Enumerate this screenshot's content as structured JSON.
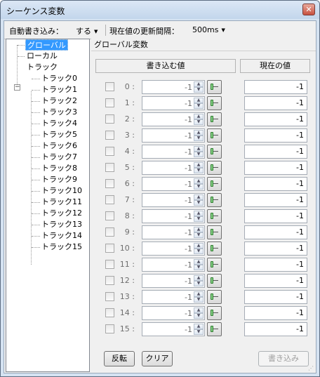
{
  "window": {
    "title": "シーケンス変数",
    "close_icon": "close-icon"
  },
  "toolbar": {
    "auto_write_label": "自動書き込み：",
    "auto_write_value": "する",
    "interval_label": "現在値の更新間隔：",
    "interval_value": "500ms"
  },
  "tree": {
    "global": "グローバル",
    "local": "ローカル",
    "track": "トラック",
    "tracks": [
      "トラック0",
      "トラック1",
      "トラック2",
      "トラック3",
      "トラック4",
      "トラック5",
      "トラック6",
      "トラック7",
      "トラック8",
      "トラック9",
      "トラック10",
      "トラック11",
      "トラック12",
      "トラック13",
      "トラック14",
      "トラック15"
    ]
  },
  "panel": {
    "title": "グローバル変数",
    "write_header": "書き込む値",
    "current_header": "現在の値"
  },
  "rows": [
    {
      "label": "0 :",
      "value": "-1",
      "current": "-1"
    },
    {
      "label": "1 :",
      "value": "-1",
      "current": "-1"
    },
    {
      "label": "2 :",
      "value": "-1",
      "current": "-1"
    },
    {
      "label": "3 :",
      "value": "-1",
      "current": "-1"
    },
    {
      "label": "4 :",
      "value": "-1",
      "current": "-1"
    },
    {
      "label": "5 :",
      "value": "-1",
      "current": "-1"
    },
    {
      "label": "6 :",
      "value": "-1",
      "current": "-1"
    },
    {
      "label": "7 :",
      "value": "-1",
      "current": "-1"
    },
    {
      "label": "8 :",
      "value": "-1",
      "current": "-1"
    },
    {
      "label": "9 :",
      "value": "-1",
      "current": "-1"
    },
    {
      "label": "10 :",
      "value": "-1",
      "current": "-1"
    },
    {
      "label": "11 :",
      "value": "-1",
      "current": "-1"
    },
    {
      "label": "12 :",
      "value": "-1",
      "current": "-1"
    },
    {
      "label": "13 :",
      "value": "-1",
      "current": "-1"
    },
    {
      "label": "14 :",
      "value": "-1",
      "current": "-1"
    },
    {
      "label": "15 :",
      "value": "-1",
      "current": "-1"
    }
  ],
  "buttons": {
    "invert": "反転",
    "clear": "クリア",
    "write": "書き込み"
  }
}
